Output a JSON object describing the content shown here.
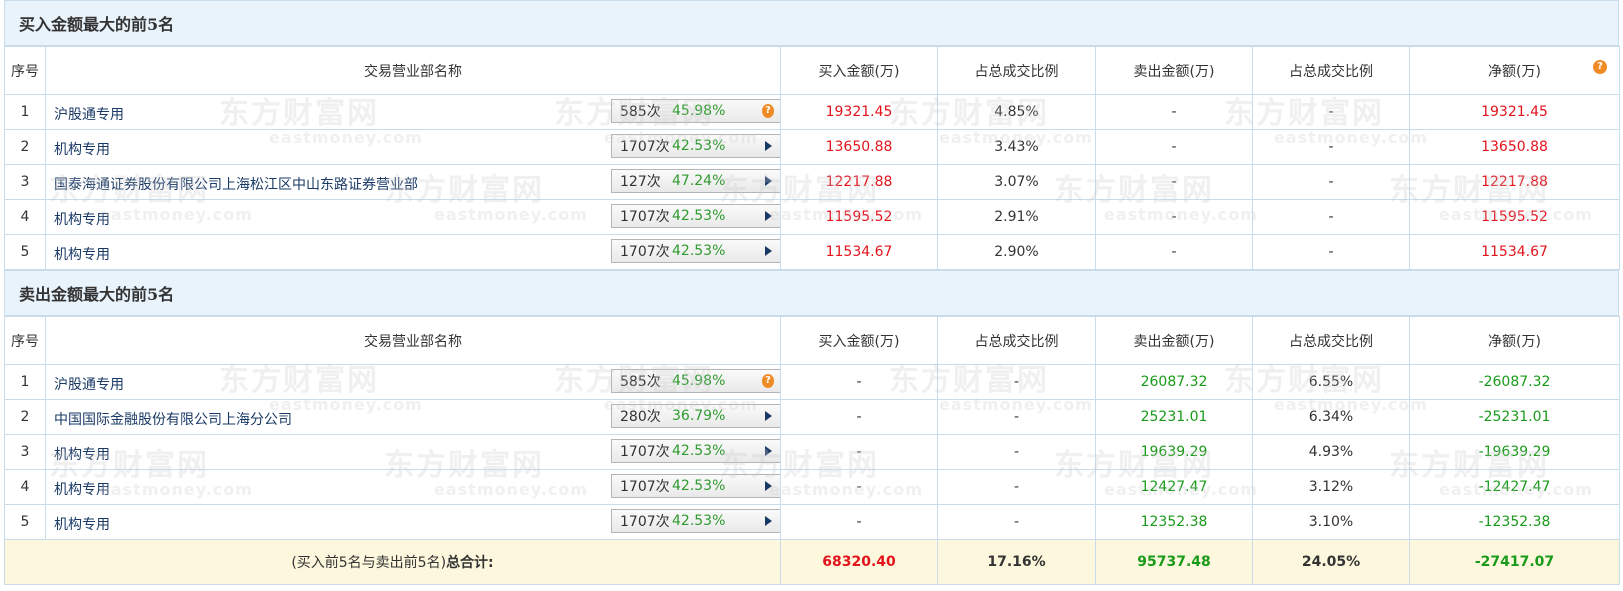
{
  "buy_section": {
    "title": "买入金额最大的前5名",
    "headers": [
      "序号",
      "交易营业部名称",
      "买入金额(万)",
      "占总成交比例",
      "卖出金额(万)",
      "占总成交比例",
      "净额(万)"
    ],
    "rows": [
      {
        "idx": "1",
        "name": "沪股通专用",
        "count": "585次",
        "pct": "45.98%",
        "icon": "question-icon",
        "buy": "19321.45",
        "buy_ratio": "4.85%",
        "sell": "-",
        "sell_ratio": "-",
        "net": "19321.45"
      },
      {
        "idx": "2",
        "name": "机构专用",
        "count": "1707次",
        "pct": "42.53%",
        "icon": "arrow-right-icon",
        "buy": "13650.88",
        "buy_ratio": "3.43%",
        "sell": "-",
        "sell_ratio": "-",
        "net": "13650.88"
      },
      {
        "idx": "3",
        "name": "国泰海通证券股份有限公司上海松江区中山东路证券营业部",
        "count": "127次",
        "pct": "47.24%",
        "icon": "arrow-right-icon",
        "buy": "12217.88",
        "buy_ratio": "3.07%",
        "sell": "-",
        "sell_ratio": "-",
        "net": "12217.88"
      },
      {
        "idx": "4",
        "name": "机构专用",
        "count": "1707次",
        "pct": "42.53%",
        "icon": "arrow-right-icon",
        "buy": "11595.52",
        "buy_ratio": "2.91%",
        "sell": "-",
        "sell_ratio": "-",
        "net": "11595.52"
      },
      {
        "idx": "5",
        "name": "机构专用",
        "count": "1707次",
        "pct": "42.53%",
        "icon": "arrow-right-icon",
        "buy": "11534.67",
        "buy_ratio": "2.90%",
        "sell": "-",
        "sell_ratio": "-",
        "net": "11534.67"
      }
    ]
  },
  "sell_section": {
    "title": "卖出金额最大的前5名",
    "headers": [
      "序号",
      "交易营业部名称",
      "买入金额(万)",
      "占总成交比例",
      "卖出金额(万)",
      "占总成交比例",
      "净额(万)"
    ],
    "rows": [
      {
        "idx": "1",
        "name": "沪股通专用",
        "count": "585次",
        "pct": "45.98%",
        "icon": "question-icon",
        "buy": "-",
        "buy_ratio": "-",
        "sell": "26087.32",
        "sell_ratio": "6.55%",
        "net": "-26087.32"
      },
      {
        "idx": "2",
        "name": "中国国际金融股份有限公司上海分公司",
        "count": "280次",
        "pct": "36.79%",
        "icon": "arrow-right-icon",
        "buy": "-",
        "buy_ratio": "-",
        "sell": "25231.01",
        "sell_ratio": "6.34%",
        "net": "-25231.01"
      },
      {
        "idx": "3",
        "name": "机构专用",
        "count": "1707次",
        "pct": "42.53%",
        "icon": "arrow-right-icon",
        "buy": "-",
        "buy_ratio": "-",
        "sell": "19639.29",
        "sell_ratio": "4.93%",
        "net": "-19639.29"
      },
      {
        "idx": "4",
        "name": "机构专用",
        "count": "1707次",
        "pct": "42.53%",
        "icon": "arrow-right-icon",
        "buy": "-",
        "buy_ratio": "-",
        "sell": "12427.47",
        "sell_ratio": "3.12%",
        "net": "-12427.47"
      },
      {
        "idx": "5",
        "name": "机构专用",
        "count": "1707次",
        "pct": "42.53%",
        "icon": "arrow-right-icon",
        "buy": "-",
        "buy_ratio": "-",
        "sell": "12352.38",
        "sell_ratio": "3.10%",
        "net": "-12352.38"
      }
    ]
  },
  "totals": {
    "label_prefix": "(买入前5名与卖出前5名)",
    "label_bold": "总合计:",
    "buy": "68320.40",
    "buy_ratio": "17.16%",
    "sell": "95737.48",
    "sell_ratio": "24.05%",
    "net": "-27417.07"
  },
  "watermark": {
    "cn": "东方财富网",
    "en": "eastmoney.com"
  },
  "colors": {
    "positive": "#e3131c",
    "negative": "#1a9a1a",
    "header_bg": "#e8f3fb",
    "total_bg": "#fdf8dd",
    "icon_orange": "#f08a24"
  }
}
